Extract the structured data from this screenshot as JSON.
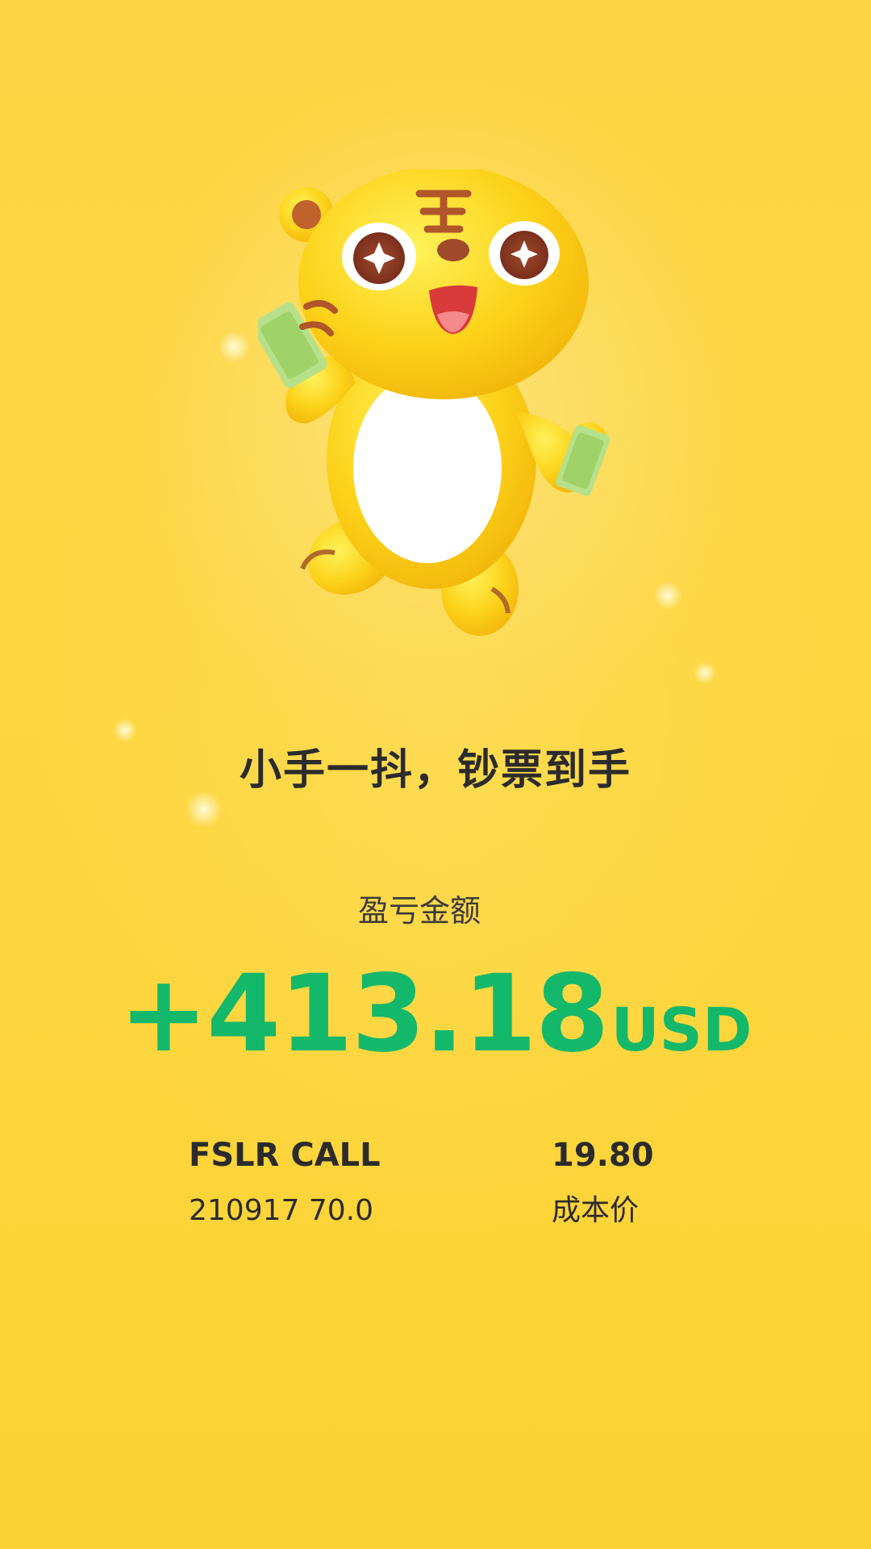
{
  "mascot": {
    "icon": "tiger-mascot-icon"
  },
  "slogan": "小手一抖，钞票到手",
  "pnl": {
    "label": "盈亏金额",
    "amount": "+413.18",
    "currency": "USD",
    "color": "#14b86a"
  },
  "position": {
    "name": "FSLR CALL",
    "contract": "210917 70.0",
    "cost_value": "19.80",
    "cost_label": "成本价"
  },
  "colors": {
    "background": "#fdd33a",
    "text": "#2b2b2b",
    "profit": "#14b86a"
  }
}
